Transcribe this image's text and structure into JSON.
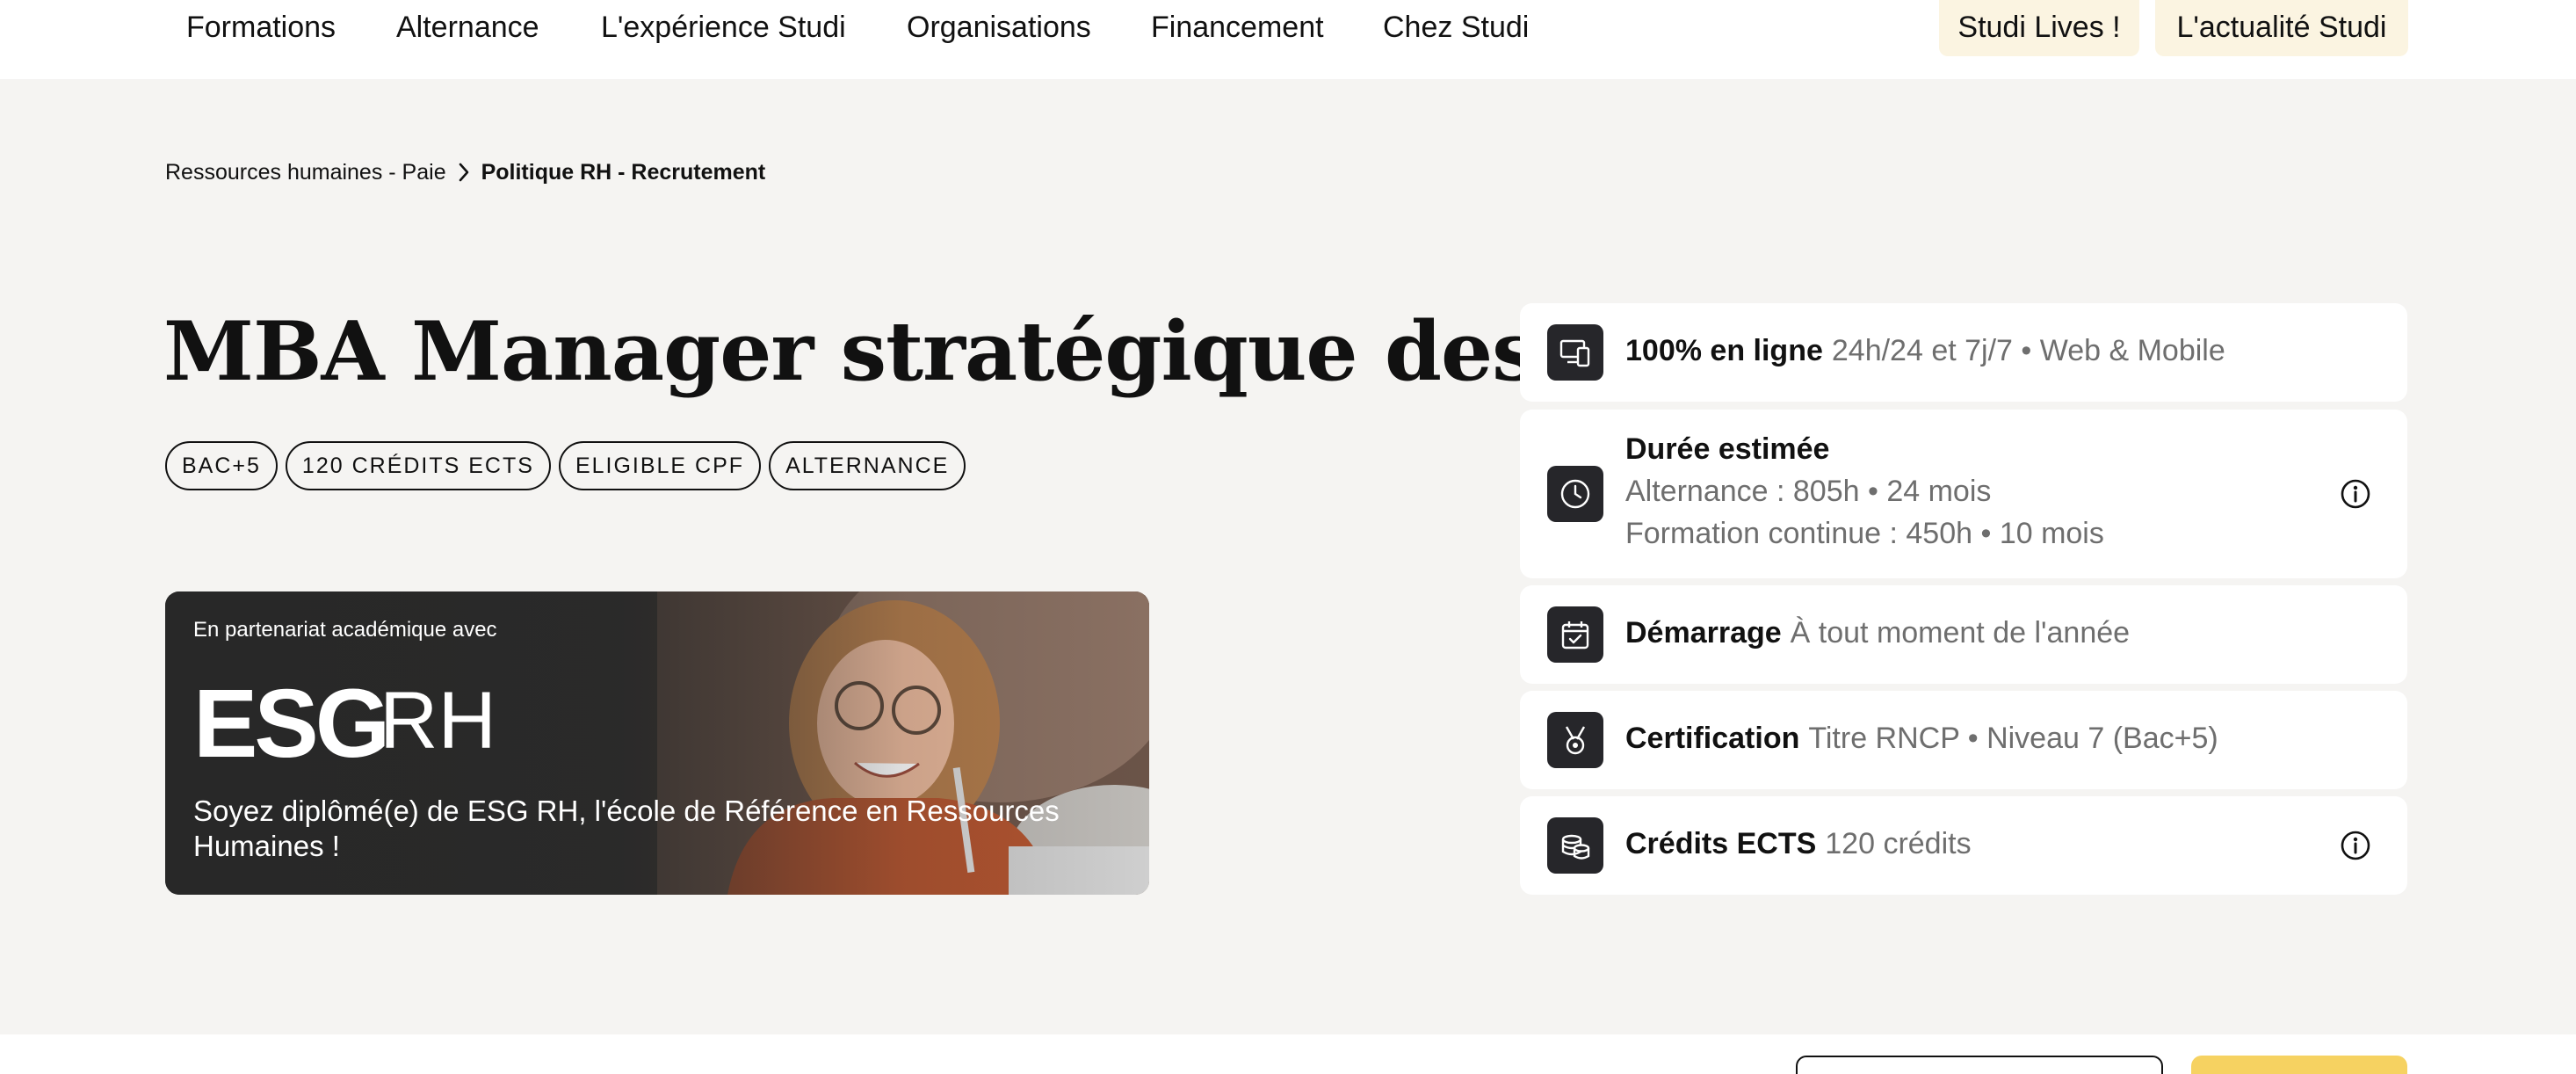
{
  "nav": {
    "items": [
      "Formations",
      "Alternance",
      "L'expérience Studi",
      "Organisations",
      "Financement",
      "Chez Studi"
    ],
    "highlights": [
      "Studi Lives !",
      "L'actualité Studi"
    ]
  },
  "breadcrumb": {
    "parent": "Ressources humaines - Paie",
    "current": "Politique RH - Recrutement"
  },
  "page": {
    "title": "MBA Manager stratégique des RH",
    "tags": [
      "BAC+5",
      "120 CRÉDITS ECTS",
      "ELIGIBLE CPF",
      "ALTERNANCE"
    ]
  },
  "banner": {
    "partner_label": "En partenariat académique avec",
    "logo_text": "ESG RH",
    "tagline": "Soyez diplômé(e) de ESG RH, l'école de Référence en Ressources Humaines !"
  },
  "cards": {
    "online": {
      "label": "100% en ligne",
      "value": "24h/24 et 7j/7 • Web & Mobile",
      "icon": "devices-icon"
    },
    "duration": {
      "label": "Durée estimée",
      "line1": "Alternance : 805h • 24 mois",
      "line2": "Formation continue : 450h • 10 mois",
      "icon": "clock-icon"
    },
    "start": {
      "label": "Démarrage",
      "value": "À tout moment de l'année",
      "icon": "calendar-check-icon"
    },
    "certification": {
      "label": "Certification",
      "value": "Titre RNCP • Niveau 7 (Bac+5)",
      "icon": "medal-icon"
    },
    "credits": {
      "label": "Crédits ECTS",
      "value": "120 crédits",
      "icon": "coins-icon"
    }
  },
  "colors": {
    "background": "#f5f4f2",
    "nav_highlight": "#fbf4e1",
    "icon_box": "#26262a",
    "muted_text": "#6e6e6e",
    "primary_button": "#f6d261"
  }
}
